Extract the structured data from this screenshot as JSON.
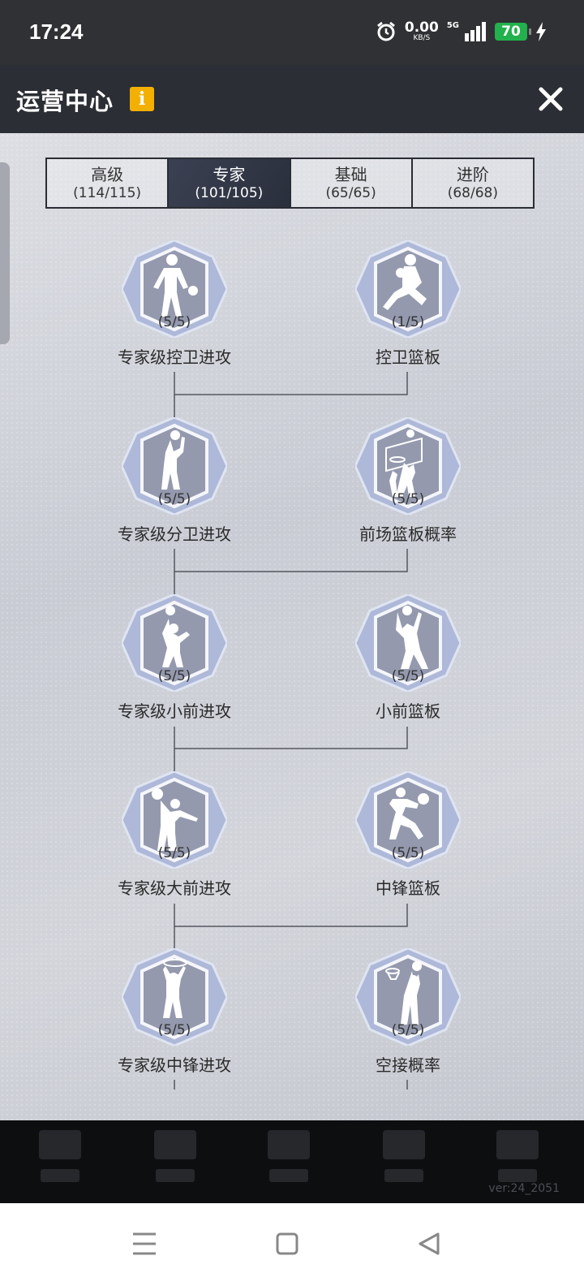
{
  "status": {
    "time": "17:24",
    "net_speed": "0.00",
    "net_unit": "KB/S",
    "signal": "5G",
    "battery": "70"
  },
  "header": {
    "title": "运营中心",
    "info": "i"
  },
  "tabs": [
    {
      "name": "高级",
      "count": "(114/115)",
      "active": false
    },
    {
      "name": "专家",
      "count": "(101/105)",
      "active": true
    },
    {
      "name": "基础",
      "count": "(65/65)",
      "active": false
    },
    {
      "name": "进阶",
      "count": "(68/68)",
      "active": false
    }
  ],
  "skills": {
    "left": [
      {
        "label": "专家级控卫进攻",
        "progress": "(5/5)",
        "icon": "dribble-player-icon"
      },
      {
        "label": "专家级分卫进攻",
        "progress": "(5/5)",
        "icon": "shooting-player-icon"
      },
      {
        "label": "专家级小前进攻",
        "progress": "(5/5)",
        "icon": "jump-shot-player-icon"
      },
      {
        "label": "专家级大前进攻",
        "progress": "(5/5)",
        "icon": "layup-player-icon"
      },
      {
        "label": "专家级中锋进攻",
        "progress": "(5/5)",
        "icon": "dunk-player-icon"
      }
    ],
    "right": [
      {
        "label": "控卫篮板",
        "progress": "(1/5)",
        "icon": "lunge-player-icon"
      },
      {
        "label": "前场篮板概率",
        "progress": "(5/5)",
        "icon": "rebound-hoop-icon"
      },
      {
        "label": "小前篮板",
        "progress": "(5/5)",
        "icon": "catch-player-icon"
      },
      {
        "label": "中锋篮板",
        "progress": "(5/5)",
        "icon": "hold-ball-player-icon"
      },
      {
        "label": "空接概率",
        "progress": "(5/5)",
        "icon": "alley-oop-icon"
      }
    ]
  },
  "version": "ver:24_2051"
}
